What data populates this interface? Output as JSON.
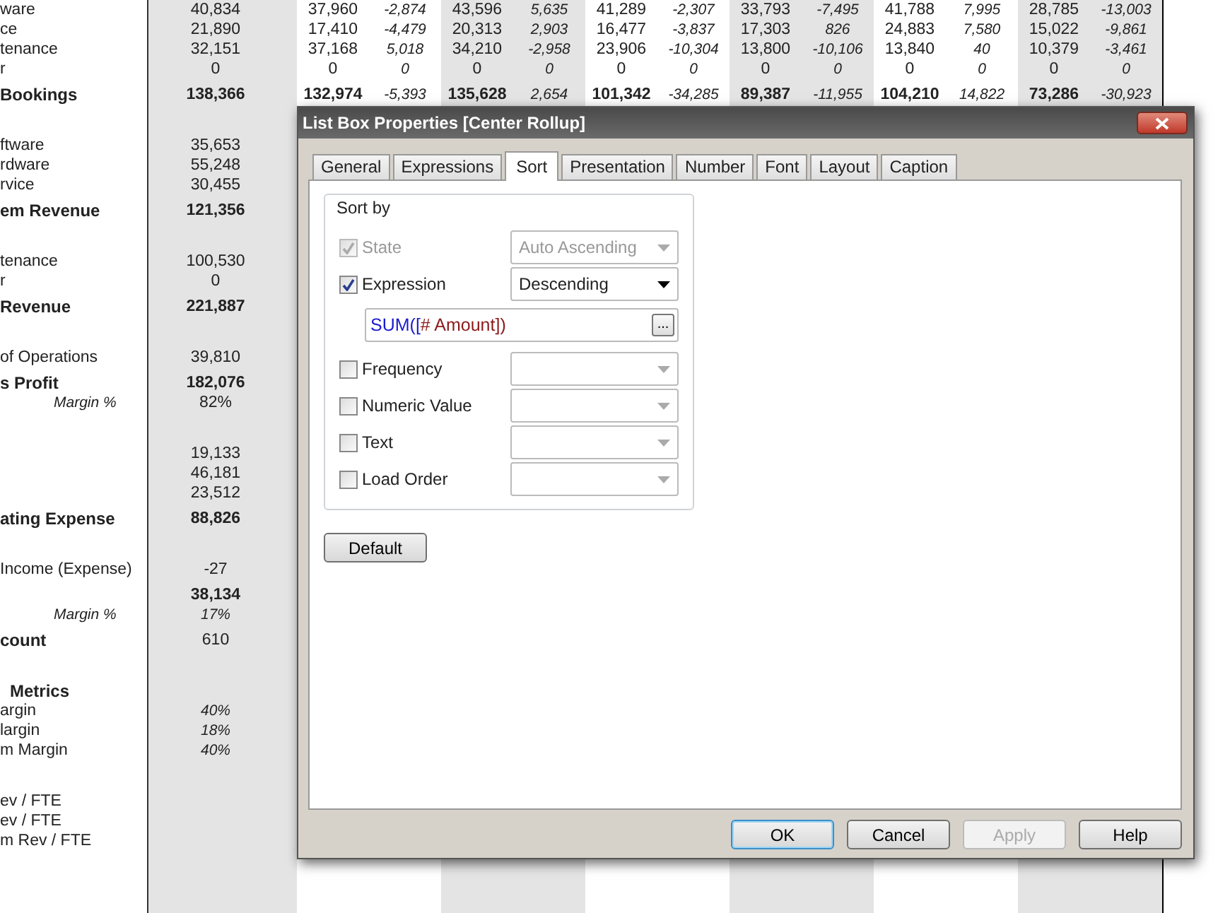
{
  "report": {
    "rows": [
      {
        "kind": "line",
        "label": "ware",
        "values": [
          "40,834",
          "37,960",
          "-2,874",
          "43,596",
          "5,635",
          "41,289",
          "-2,307",
          "33,793",
          "-7,495",
          "41,788",
          "7,995",
          "28,785",
          "-13,003"
        ]
      },
      {
        "kind": "line",
        "label": "ce",
        "values": [
          "21,890",
          "17,410",
          "-4,479",
          "20,313",
          "2,903",
          "16,477",
          "-3,837",
          "17,303",
          "826",
          "24,883",
          "7,580",
          "15,022",
          "-9,861"
        ]
      },
      {
        "kind": "line",
        "label": "tenance",
        "values": [
          "32,151",
          "37,168",
          "5,018",
          "34,210",
          "-2,958",
          "23,906",
          "-10,304",
          "13,800",
          "-10,106",
          "13,840",
          "40",
          "10,379",
          "-3,461"
        ]
      },
      {
        "kind": "line",
        "label": "r",
        "values": [
          "0",
          "0",
          "0",
          "0",
          "0",
          "0",
          "0",
          "0",
          "0",
          "0",
          "0",
          "0",
          "0"
        ]
      },
      {
        "kind": "total",
        "label": "Bookings",
        "values": [
          "138,366",
          "132,974",
          "-5,393",
          "135,628",
          "2,654",
          "101,342",
          "-34,285",
          "89,387",
          "-11,955",
          "104,210",
          "14,822",
          "73,286",
          "-30,923"
        ]
      },
      {
        "kind": "line",
        "space_before": true,
        "label": "ftware",
        "values": [
          "35,653"
        ]
      },
      {
        "kind": "line",
        "label": "rdware",
        "values": [
          "55,248"
        ]
      },
      {
        "kind": "line",
        "label": "rvice",
        "values": [
          "30,455"
        ]
      },
      {
        "kind": "total",
        "label": "em Revenue",
        "values": [
          "121,356"
        ]
      },
      {
        "kind": "line",
        "space_before": true,
        "label": "tenance",
        "values": [
          "100,530"
        ]
      },
      {
        "kind": "line",
        "label": "r",
        "values": [
          "0"
        ]
      },
      {
        "kind": "total",
        "label": "Revenue",
        "values": [
          "221,887"
        ]
      },
      {
        "kind": "line",
        "space_before": true,
        "label": "of Operations",
        "values": [
          "39,810"
        ]
      },
      {
        "kind": "total",
        "label": "s Profit",
        "values": [
          "182,076"
        ]
      },
      {
        "kind": "note",
        "label": "Margin %",
        "values": [
          "82%"
        ]
      },
      {
        "kind": "line",
        "space_before": true,
        "values": [
          "19,133"
        ]
      },
      {
        "kind": "line",
        "values": [
          "46,181"
        ]
      },
      {
        "kind": "line",
        "values": [
          "23,512"
        ]
      },
      {
        "kind": "total",
        "label": "ating Expense",
        "values": [
          "88,826"
        ]
      },
      {
        "kind": "line",
        "space_before": true,
        "label": "Income (Expense)",
        "values": [
          "-27"
        ]
      },
      {
        "kind": "total",
        "values": [
          "38,134"
        ]
      },
      {
        "kind": "noterate",
        "label": "Margin %",
        "values": [
          "17%"
        ]
      },
      {
        "kind": "count",
        "label": "count",
        "values": [
          "610"
        ]
      },
      {
        "kind": "heading",
        "space_before": true,
        "label": "Metrics"
      },
      {
        "kind": "rate",
        "label": "argin",
        "values": [
          "40%"
        ]
      },
      {
        "kind": "rate",
        "label": "largin",
        "values": [
          "18%"
        ]
      },
      {
        "kind": "rate",
        "label": "m Margin",
        "values": [
          "40%"
        ]
      },
      {
        "kind": "line",
        "space_before": true,
        "label": "ev / FTE"
      },
      {
        "kind": "line",
        "label": "ev / FTE"
      },
      {
        "kind": "line",
        "label": "m Rev / FTE"
      }
    ]
  },
  "dialog": {
    "title": "List Box Properties [Center Rollup]",
    "tabs": [
      {
        "label": "General",
        "selected": false
      },
      {
        "label": "Expressions",
        "selected": false
      },
      {
        "label": "Sort",
        "selected": true
      },
      {
        "label": "Presentation",
        "selected": false
      },
      {
        "label": "Number",
        "selected": false
      },
      {
        "label": "Font",
        "selected": false
      },
      {
        "label": "Layout",
        "selected": false
      },
      {
        "label": "Caption",
        "selected": false
      }
    ],
    "group_title": "Sort by",
    "options": [
      {
        "label": "State",
        "checked": true,
        "disabled": true,
        "order": {
          "value": "Auto Ascending",
          "disabled": true
        }
      },
      {
        "label": "Expression",
        "checked": true,
        "disabled": false,
        "order": {
          "value": "Descending",
          "disabled": false
        },
        "expression": [
          {
            "kind": "function",
            "text": "SUM(["
          },
          {
            "kind": "field",
            "text": "# Amount])"
          }
        ],
        "browse": "..."
      },
      {
        "label": "Frequency",
        "checked": false,
        "disabled": false,
        "order": {
          "disabled": true
        }
      },
      {
        "label": "Numeric Value",
        "checked": false,
        "disabled": false,
        "order": {
          "disabled": true
        }
      },
      {
        "label": "Text",
        "checked": false,
        "disabled": false,
        "order": {
          "disabled": true
        }
      },
      {
        "label": "Load Order",
        "checked": false,
        "disabled": false,
        "order": {
          "disabled": true
        }
      }
    ],
    "default_button": "Default",
    "buttons": [
      {
        "label": "OK",
        "default": true,
        "disabled": false
      },
      {
        "label": "Cancel",
        "default": false,
        "disabled": false
      },
      {
        "label": "Apply",
        "default": false,
        "disabled": true
      },
      {
        "label": "Help",
        "default": false,
        "disabled": false
      }
    ]
  }
}
